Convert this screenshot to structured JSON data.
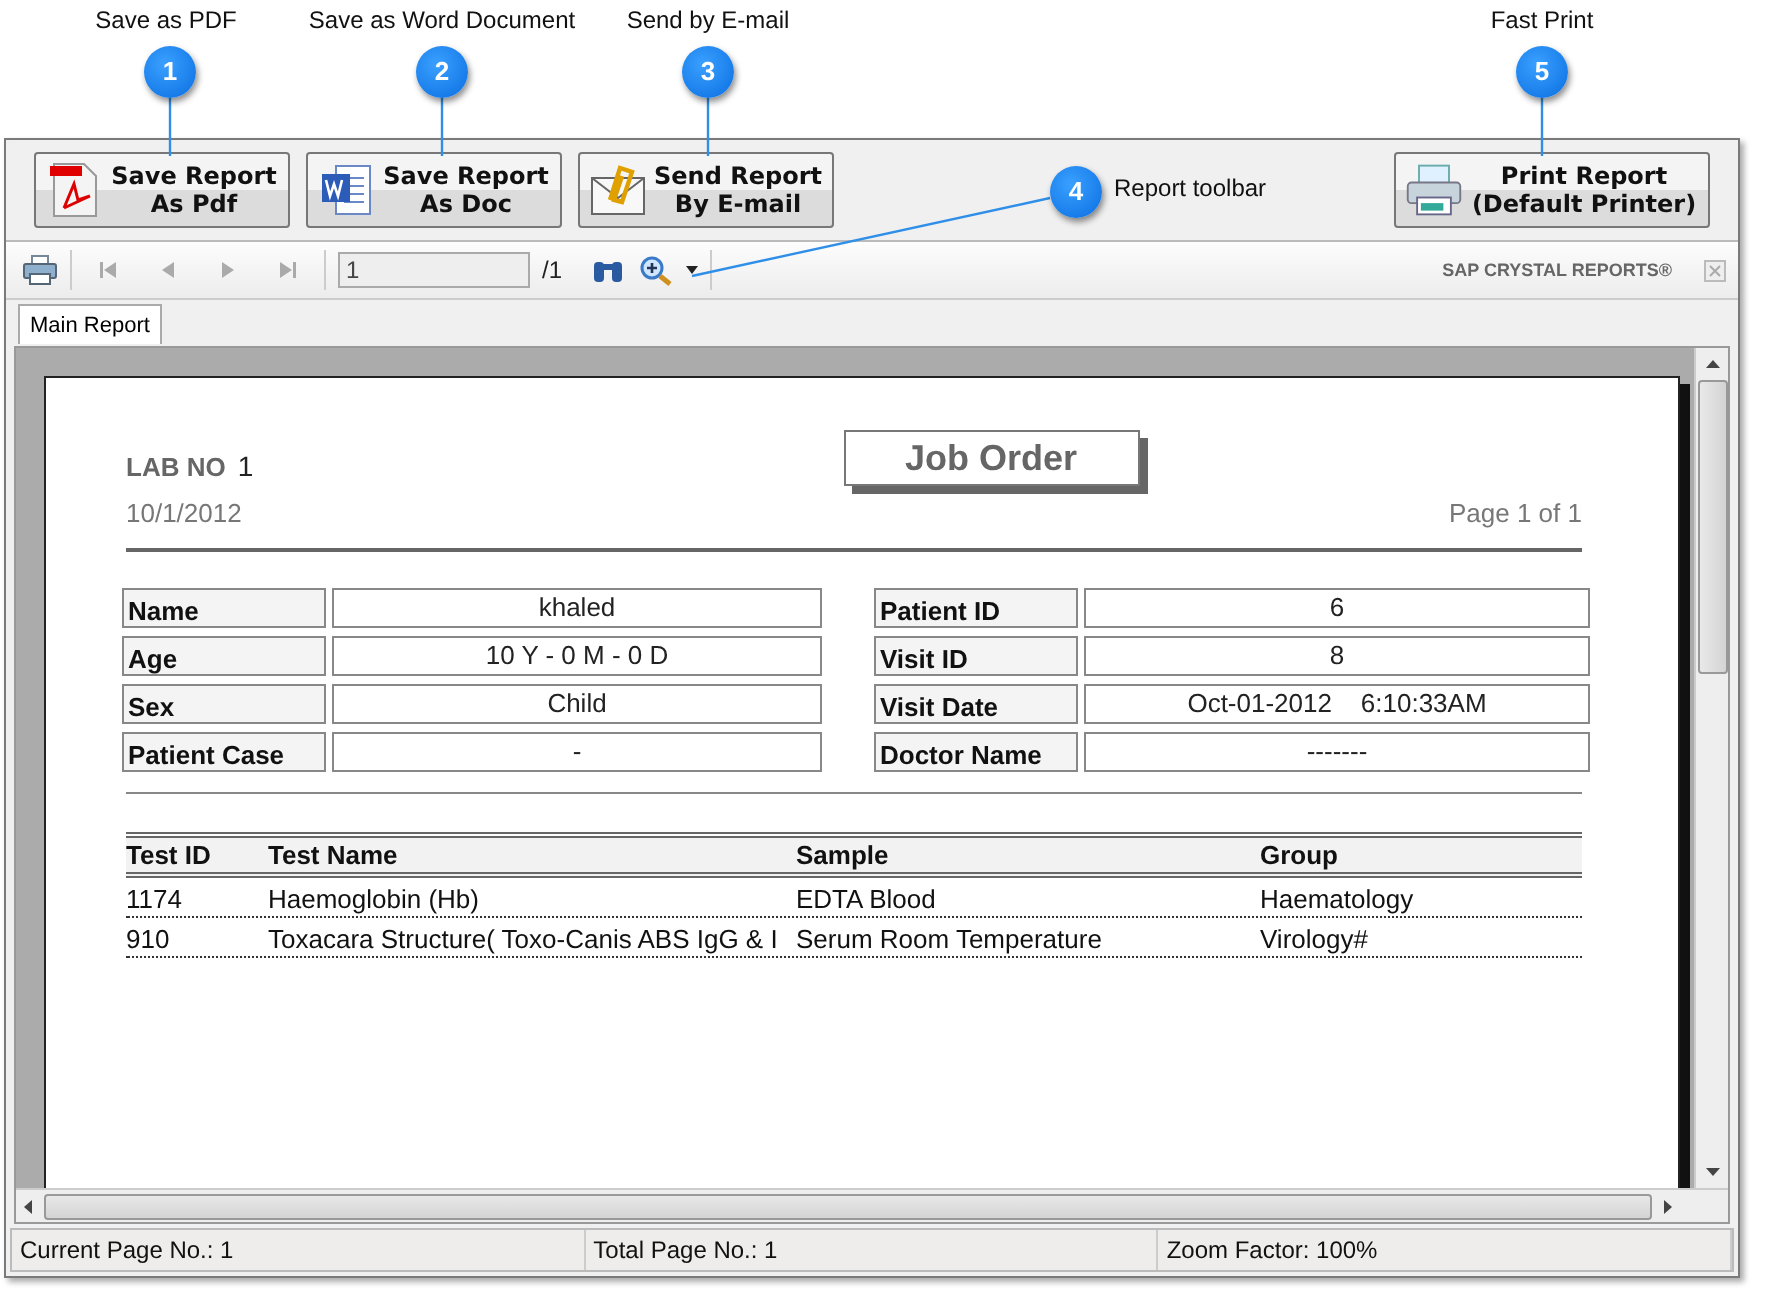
{
  "callouts": [
    {
      "number": "1",
      "label": "Save as PDF"
    },
    {
      "number": "2",
      "label": "Save as Word Document"
    },
    {
      "number": "3",
      "label": "Send by E-mail"
    },
    {
      "number": "4",
      "label": "Report toolbar"
    },
    {
      "number": "5",
      "label": "Fast Print"
    }
  ],
  "action_buttons": [
    {
      "kind": "pdf",
      "line1": "Save Report",
      "line2": "As Pdf"
    },
    {
      "kind": "doc",
      "line1": "Save Report",
      "line2": "As Doc"
    },
    {
      "kind": "email",
      "line1": "Send Report",
      "line2": "By E-mail"
    },
    {
      "kind": "print",
      "line1": "Print Report",
      "line2": "(Default Printer)"
    }
  ],
  "toolbar": {
    "nav": [
      {
        "kind": "first",
        "disabled": true
      },
      {
        "kind": "prev",
        "disabled": true
      },
      {
        "kind": "next",
        "disabled": true
      },
      {
        "kind": "last",
        "disabled": true
      }
    ],
    "page_value": "1",
    "page_total": "/1",
    "brand": "SAP CRYSTAL REPORTS®"
  },
  "tabs": [
    {
      "label": "Main Report",
      "selected": true
    }
  ],
  "report": {
    "lab_no_label": "LAB NO",
    "lab_no": "1",
    "date": "10/1/2012",
    "title": "Job Order",
    "page": "Page 1 of 1",
    "left_fields": [
      {
        "label": "Name",
        "value": "khaled"
      },
      {
        "label": "Age",
        "value": "10 Y - 0 M - 0 D"
      },
      {
        "label": "Sex",
        "value": "Child"
      },
      {
        "label": "Patient Case",
        "value": "-"
      }
    ],
    "right_fields": [
      {
        "label": "Patient ID",
        "value": "6"
      },
      {
        "label": "Visit ID",
        "value": "8"
      },
      {
        "label": "Visit Date",
        "value": "Oct-01-2012    6:10:33AM"
      },
      {
        "label": "Doctor Name",
        "value": "-------"
      }
    ],
    "columns": [
      "Test ID",
      "Test Name",
      "Sample",
      "Group"
    ],
    "rows": [
      [
        "1174",
        "Haemoglobin (Hb)",
        "EDTA Blood",
        "Haematology"
      ],
      [
        "910",
        "Toxacara Structure( Toxo-Canis ABS IgG & I",
        "Serum Room Temperature",
        "Virology#"
      ]
    ]
  },
  "status_bar": [
    "Current Page No.: 1",
    "Total Page No.: 1",
    "Zoom Factor: 100%"
  ]
}
